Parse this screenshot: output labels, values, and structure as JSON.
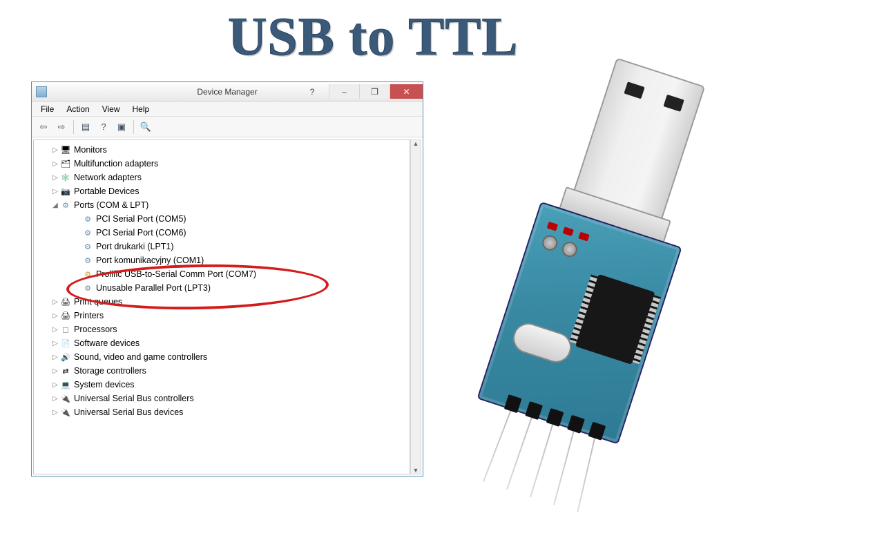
{
  "page_title": "USB to TTL",
  "window": {
    "title": "Device Manager",
    "help_glyph": "?",
    "minimize_glyph": "–",
    "maximize_glyph": "❐",
    "close_glyph": "✕"
  },
  "menubar": [
    "File",
    "Action",
    "View",
    "Help"
  ],
  "toolbar_icons": [
    "back-icon",
    "forward-icon",
    "show-hidden-icon",
    "help-icon",
    "properties-icon",
    "scan-icon"
  ],
  "tree": {
    "top_nodes": [
      {
        "label": "Monitors",
        "icon": "icon-monitor"
      },
      {
        "label": "Multifunction adapters",
        "icon": "icon-adapter"
      },
      {
        "label": "Network adapters",
        "icon": "icon-net"
      },
      {
        "label": "Portable Devices",
        "icon": "icon-portable"
      }
    ],
    "ports_label": "Ports (COM & LPT)",
    "ports_children": [
      {
        "label": "PCI Serial Port (COM5)",
        "icon": "icon-port"
      },
      {
        "label": "PCI Serial Port (COM6)",
        "icon": "icon-port"
      },
      {
        "label": "Port drukarki (LPT1)",
        "icon": "icon-port"
      },
      {
        "label": "Port komunikacyjny (COM1)",
        "icon": "icon-port"
      },
      {
        "label": "Prolific USB-to-Serial Comm Port (COM7)",
        "icon": "icon-port-warn"
      },
      {
        "label": "Unusable Parallel Port (LPT3)",
        "icon": "icon-port"
      }
    ],
    "bottom_nodes": [
      {
        "label": "Print queues",
        "icon": "icon-printq"
      },
      {
        "label": "Printers",
        "icon": "icon-printer"
      },
      {
        "label": "Processors",
        "icon": "icon-cpu"
      },
      {
        "label": "Software devices",
        "icon": "icon-sw"
      },
      {
        "label": "Sound, video and game controllers",
        "icon": "icon-sound"
      },
      {
        "label": "Storage controllers",
        "icon": "icon-storage"
      },
      {
        "label": "System devices",
        "icon": "icon-sys"
      },
      {
        "label": "Universal Serial Bus controllers",
        "icon": "icon-usb"
      },
      {
        "label": "Universal Serial Bus devices",
        "icon": "icon-usb"
      }
    ]
  },
  "scrollbar": {
    "up": "▲",
    "down": "▼"
  },
  "annotation": {
    "circled_items": [
      "Port komunikacyjny (COM1)",
      "Prolific USB-to-Serial Comm Port (COM7)"
    ],
    "circle_color": "#d41c1c"
  }
}
